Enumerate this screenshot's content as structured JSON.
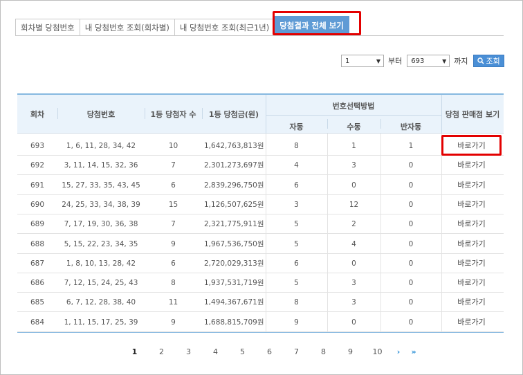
{
  "tabs": [
    {
      "label": "회차별 당첨번호",
      "active": false
    },
    {
      "label": "내 당첨번호 조회(회차별)",
      "active": false
    },
    {
      "label": "내 당첨번호 조회(최근1년)",
      "active": false
    },
    {
      "label": "당첨결과 전체 보기",
      "active": true
    }
  ],
  "filter": {
    "from_value": "1",
    "from_label": "부터",
    "to_value": "693",
    "to_label": "까지",
    "search_label": "조회"
  },
  "table": {
    "headers": {
      "round": "회차",
      "numbers": "당첨번호",
      "winners": "1등 당첨자 수",
      "prize": "1등 당첨금(원)",
      "method": "번호선택방법",
      "auto": "자동",
      "manual": "수동",
      "semi": "반자동",
      "shop": "당첨 판매점 보기"
    },
    "rows": [
      {
        "round": "693",
        "numbers": "1, 6, 11, 28, 34, 42",
        "winners": "10",
        "prize": "1,642,763,813원",
        "auto": "8",
        "manual": "1",
        "semi": "1",
        "link": "바로가기"
      },
      {
        "round": "692",
        "numbers": "3, 11, 14, 15, 32, 36",
        "winners": "7",
        "prize": "2,301,273,697원",
        "auto": "4",
        "manual": "3",
        "semi": "0",
        "link": "바로가기"
      },
      {
        "round": "691",
        "numbers": "15, 27, 33, 35, 43, 45",
        "winners": "6",
        "prize": "2,839,296,750원",
        "auto": "6",
        "manual": "0",
        "semi": "0",
        "link": "바로가기"
      },
      {
        "round": "690",
        "numbers": "24, 25, 33, 34, 38, 39",
        "winners": "15",
        "prize": "1,126,507,625원",
        "auto": "3",
        "manual": "12",
        "semi": "0",
        "link": "바로가기"
      },
      {
        "round": "689",
        "numbers": "7, 17, 19, 30, 36, 38",
        "winners": "7",
        "prize": "2,321,775,911원",
        "auto": "5",
        "manual": "2",
        "semi": "0",
        "link": "바로가기"
      },
      {
        "round": "688",
        "numbers": "5, 15, 22, 23, 34, 35",
        "winners": "9",
        "prize": "1,967,536,750원",
        "auto": "5",
        "manual": "4",
        "semi": "0",
        "link": "바로가기"
      },
      {
        "round": "687",
        "numbers": "1, 8, 10, 13, 28, 42",
        "winners": "6",
        "prize": "2,720,029,313원",
        "auto": "6",
        "manual": "0",
        "semi": "0",
        "link": "바로가기"
      },
      {
        "round": "686",
        "numbers": "7, 12, 15, 24, 25, 43",
        "winners": "8",
        "prize": "1,937,531,719원",
        "auto": "5",
        "manual": "3",
        "semi": "0",
        "link": "바로가기"
      },
      {
        "round": "685",
        "numbers": "6, 7, 12, 28, 38, 40",
        "winners": "11",
        "prize": "1,494,367,671원",
        "auto": "8",
        "manual": "3",
        "semi": "0",
        "link": "바로가기"
      },
      {
        "round": "684",
        "numbers": "1, 11, 15, 17, 25, 39",
        "winners": "9",
        "prize": "1,688,815,709원",
        "auto": "9",
        "manual": "0",
        "semi": "0",
        "link": "바로가기"
      }
    ]
  },
  "pagination": {
    "pages": [
      "1",
      "2",
      "3",
      "4",
      "5",
      "6",
      "7",
      "8",
      "9",
      "10"
    ],
    "current": "1",
    "next": "›",
    "last": "»"
  },
  "colors": {
    "accent": "#5f9bd5",
    "highlight": "#e30000",
    "header_bg": "#eaf3fb"
  }
}
